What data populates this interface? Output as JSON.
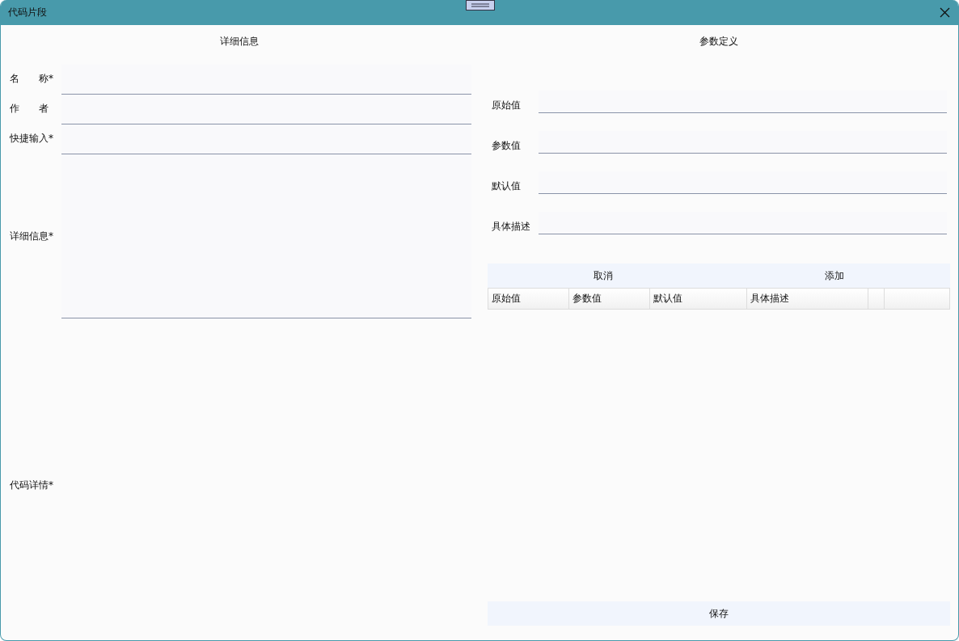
{
  "window": {
    "title": "代码片段"
  },
  "details": {
    "heading": "详细信息",
    "fields": [
      {
        "label": "名　　称*",
        "kind": "line"
      },
      {
        "label": "作　　者",
        "kind": "line"
      },
      {
        "label": "快捷输入*",
        "kind": "line"
      },
      {
        "label": "详细信息*",
        "kind": "area"
      },
      {
        "label": "代码详情*",
        "kind": "editor"
      }
    ]
  },
  "params": {
    "heading": "参数定义",
    "fields": [
      {
        "label": "原始值"
      },
      {
        "label": "参数值"
      },
      {
        "label": "默认值"
      },
      {
        "label": "具体描述"
      }
    ],
    "buttons": [
      "取消",
      "添加"
    ],
    "table": {
      "columns": [
        "原始值",
        "参数值",
        "默认值",
        "具体描述"
      ]
    },
    "save_button": "保存"
  }
}
